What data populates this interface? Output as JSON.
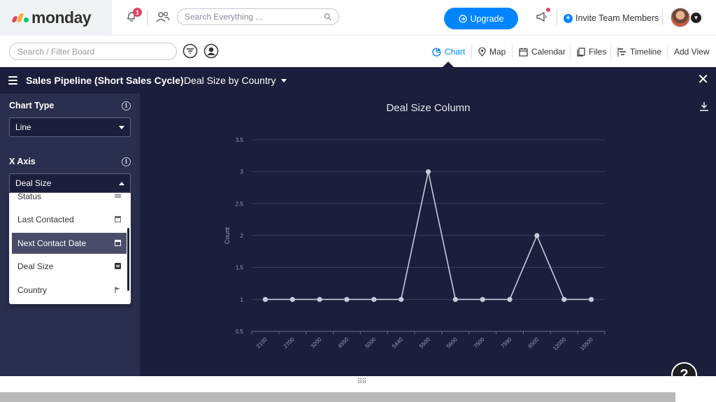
{
  "topbar": {
    "logo_text": "monday",
    "notifications_count": "1",
    "search_placeholder": "Search Everything ...",
    "upgrade_label": "Upgrade",
    "invite_label": "Invite Team Members"
  },
  "subbar": {
    "filter_placeholder": "Search / Filter Board",
    "views": [
      {
        "label": "Chart",
        "icon": "chart-icon"
      },
      {
        "label": "Map",
        "icon": "map-pin-icon"
      },
      {
        "label": "Calendar",
        "icon": "calendar-icon"
      },
      {
        "label": "Files",
        "icon": "files-icon"
      },
      {
        "label": "Timeline",
        "icon": "timeline-icon"
      },
      {
        "label": "Add View",
        "icon": ""
      }
    ]
  },
  "board": {
    "title": "Sales Pipeline (Short Sales Cycle)",
    "view_name": "Deal Size by Country"
  },
  "panel": {
    "chart_type_label": "Chart Type",
    "chart_type_value": "Line",
    "x_axis_label": "X Axis",
    "x_axis_value": "Deal Size",
    "dropdown_items": [
      {
        "label": "Status",
        "icon": "status-icon"
      },
      {
        "label": "Last Contacted",
        "icon": "date-icon"
      },
      {
        "label": "Next Contact Date",
        "icon": "date-icon"
      },
      {
        "label": "Deal Size",
        "icon": "number-icon"
      },
      {
        "label": "Country",
        "icon": "flag-icon"
      }
    ],
    "selected_index": 2
  },
  "colors": {
    "dark_bg": "#1c1f3b",
    "panel_bg": "#2b2f4e",
    "accent": "#0085ff",
    "line": "#c9c9dc"
  },
  "chart_data": {
    "type": "line",
    "title": "Deal Size Column",
    "xlabel": "",
    "ylabel": "Count",
    "categories": [
      "2100",
      "2700",
      "3200",
      "4550",
      "5000",
      "5440",
      "5500",
      "5600",
      "7500",
      "7590",
      "8500",
      "12000",
      "15500"
    ],
    "values": [
      1,
      1,
      1,
      1,
      1,
      1,
      3,
      1,
      1,
      1,
      2,
      1,
      1
    ],
    "ylim": [
      0.5,
      3.5
    ],
    "yticks": [
      "0.5",
      "1",
      "1.5",
      "2",
      "2.5",
      "3",
      "3.5"
    ],
    "grid": true,
    "legend": "none"
  }
}
